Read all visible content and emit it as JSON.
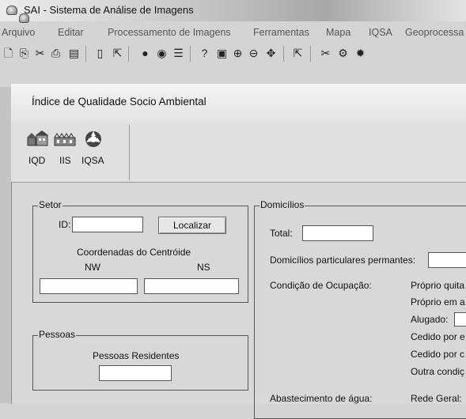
{
  "app": {
    "title": "SAI - Sistema de Análise de Imagens"
  },
  "menu": [
    "Arquivo",
    "Editar",
    "Processamento de Imagens",
    "Ferramentas",
    "Mapa",
    "IQSA",
    "Geoprocessa"
  ],
  "toolbar": {
    "icons": [
      "new-document-icon",
      "copy-icon",
      "cut-icon",
      "print-icon",
      "save-icon",
      "document-icon",
      "export-icon",
      "color-icon",
      "sphere-icon",
      "list-icon",
      "help-icon",
      "image-icon",
      "zoom-in-icon",
      "zoom-out-icon",
      "pan-icon",
      "export2-icon",
      "scissors-icon",
      "settings-icon",
      "star-icon"
    ]
  },
  "window": {
    "title": "Índice de Qualidade Socio Ambiental",
    "tabs": [
      {
        "label": "IQD",
        "icon": "houses-icon"
      },
      {
        "label": "IIS",
        "icon": "buildings-icon"
      },
      {
        "label": "IQSA",
        "icon": "cycle-icon"
      }
    ]
  },
  "setor": {
    "legend": "Setor",
    "id_label": "ID:",
    "id_value": "",
    "locate_button": "Localizar",
    "centroid_label": "Coordenadas do Centróide",
    "nw_label": "NW",
    "ns_label": "NS",
    "nw_value": "",
    "ns_value": ""
  },
  "pessoas": {
    "legend": "Pessoas",
    "residentes_label": "Pessoas Residentes",
    "residentes_value": ""
  },
  "domicilios": {
    "legend": "Domicílios",
    "total_label": "Total:",
    "total_value": "",
    "particulares_label": "Domicílios particulares permantes:",
    "particulares_value": "",
    "ocupacao_label": "Condição de Ocupação:",
    "ocupacao_items": [
      "Próprio quita",
      "Próprio em a",
      "Alugado:",
      "Cedido por e",
      "Cedido por c",
      "Outra condiç"
    ],
    "agua_label": "Abastecimento de água:",
    "agua_item": "Rede Geral:"
  }
}
